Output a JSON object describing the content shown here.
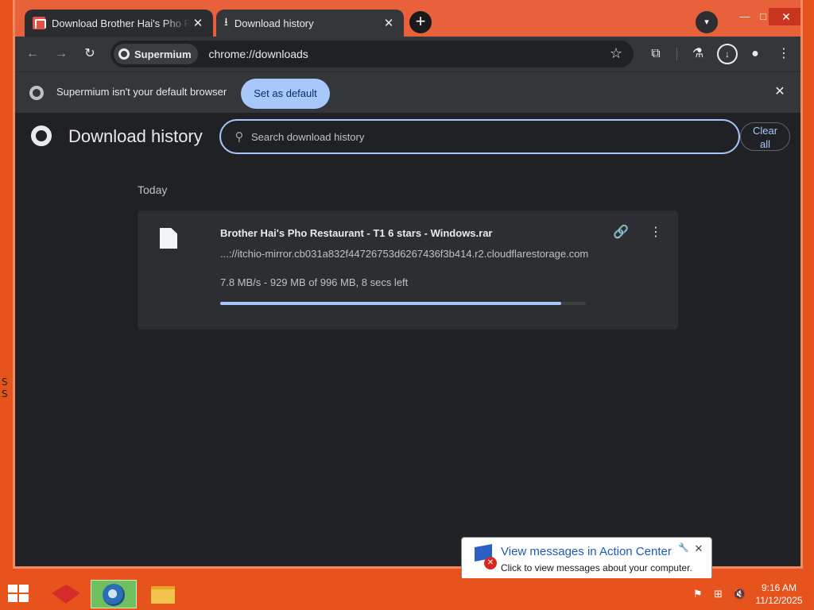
{
  "browser": {
    "tabs": [
      {
        "title": "Download Brother Hai's Pho Re",
        "active": false
      },
      {
        "title": "Download history",
        "active": true
      }
    ],
    "site_chip": "Supermium",
    "url": "chrome://downloads"
  },
  "infobar": {
    "message": "Supermium isn't your default browser",
    "button": "Set as default"
  },
  "page": {
    "title": "Download history",
    "search_placeholder": "Search download history",
    "clear_all_line1": "Clear",
    "clear_all_line2": "all"
  },
  "downloads": {
    "section": "Today",
    "item": {
      "file_name": "Brother Hai's Pho Restaurant - T1 6 stars - Windows.rar",
      "url": "...://itchio-mirror.cb031a832f44726753d6267436f3b414.r2.cloudflarestorage.com",
      "status": "7.8 MB/s - 929 MB of 996 MB, 8 secs left",
      "progress_received_mb": 929,
      "progress_total_mb": 996
    }
  },
  "action_center": {
    "title": "View messages in Action Center",
    "body": "Click to view messages about your computer."
  },
  "taskbar": {
    "time": "9:16 AM",
    "date": "11/12/2025"
  },
  "colors": {
    "desktop": "#e7531d",
    "accent": "#a8c7fa",
    "page_bg": "#202124",
    "card_bg": "#2d2e31"
  }
}
